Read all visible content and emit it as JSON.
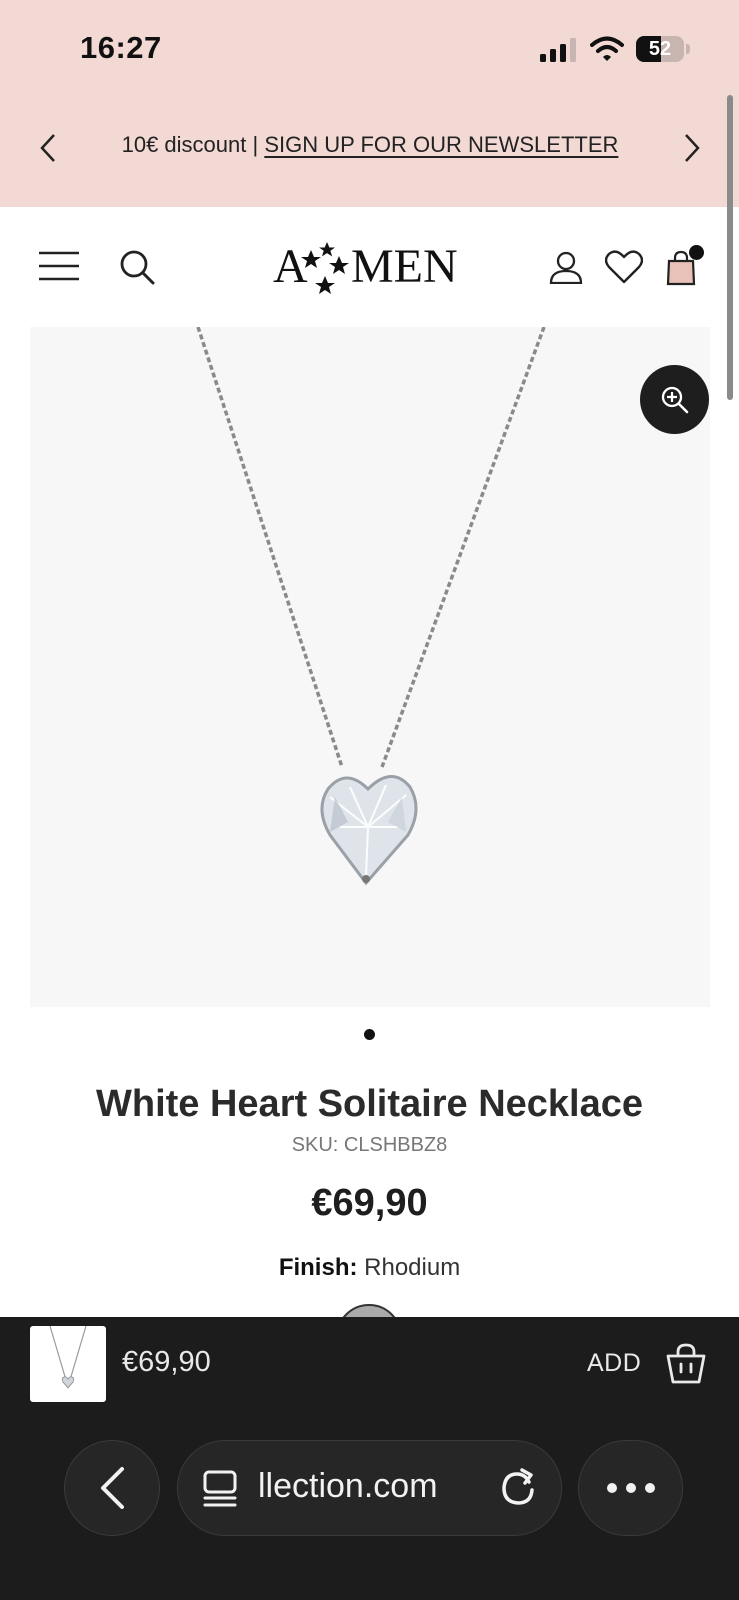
{
  "status_bar": {
    "time": "16:27",
    "battery_level": "52",
    "battery_fraction": 0.52
  },
  "promo": {
    "text": "10€ discount | ",
    "link": "SIGN UP FOR OUR NEWSLETTER"
  },
  "header": {
    "brand": "A-MEN",
    "cart_has_items": true
  },
  "product": {
    "title": "White Heart Solitaire Necklace",
    "sku": "SKU: CLSHBBZ8",
    "price": "€69,90",
    "finish_label": "Finish:",
    "finish_value": "Rhodium",
    "gallery_dot_count": 1,
    "gallery_active_index": 0
  },
  "sticky_bar": {
    "price": "€69,90",
    "add_label": "ADD"
  },
  "browser": {
    "url": "llection.com"
  },
  "colors": {
    "promo_bg": "#f3d9d3",
    "dark_bar": "#1c1c1c",
    "image_bg": "#f7f7f7"
  }
}
